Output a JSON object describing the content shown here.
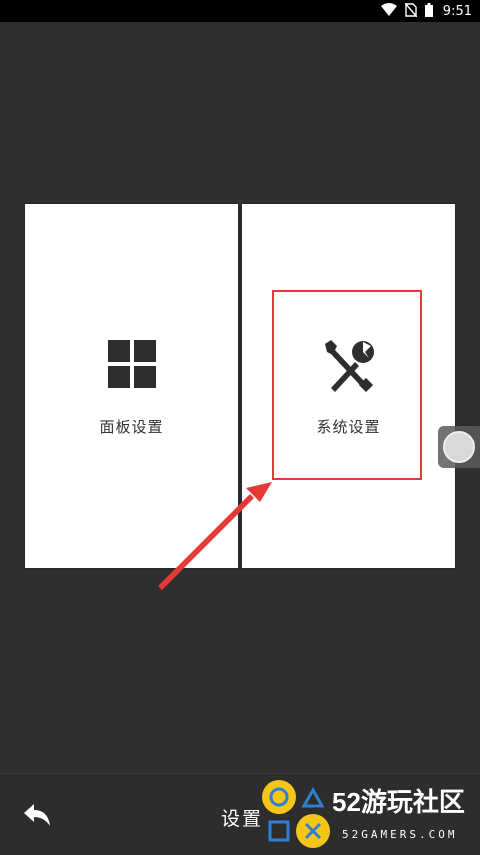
{
  "status_bar": {
    "time": "9:51",
    "icons": [
      "wifi-icon",
      "no-sim-icon",
      "battery-icon"
    ]
  },
  "cards": [
    {
      "label": "面板设置",
      "icon": "grid-icon"
    },
    {
      "label": "系统设置",
      "icon": "wrench-screwdriver-icon"
    }
  ],
  "bottom_bar": {
    "title": "设置",
    "back_icon": "back-arrow-icon"
  },
  "watermark": {
    "title": "52游玩社区",
    "subtitle": "52GAMERS.COM"
  },
  "colors": {
    "background": "#2f2f2f",
    "highlight": "#e53935",
    "watermark_yellow": "#f5c518",
    "watermark_blue": "#2f7fd0"
  }
}
